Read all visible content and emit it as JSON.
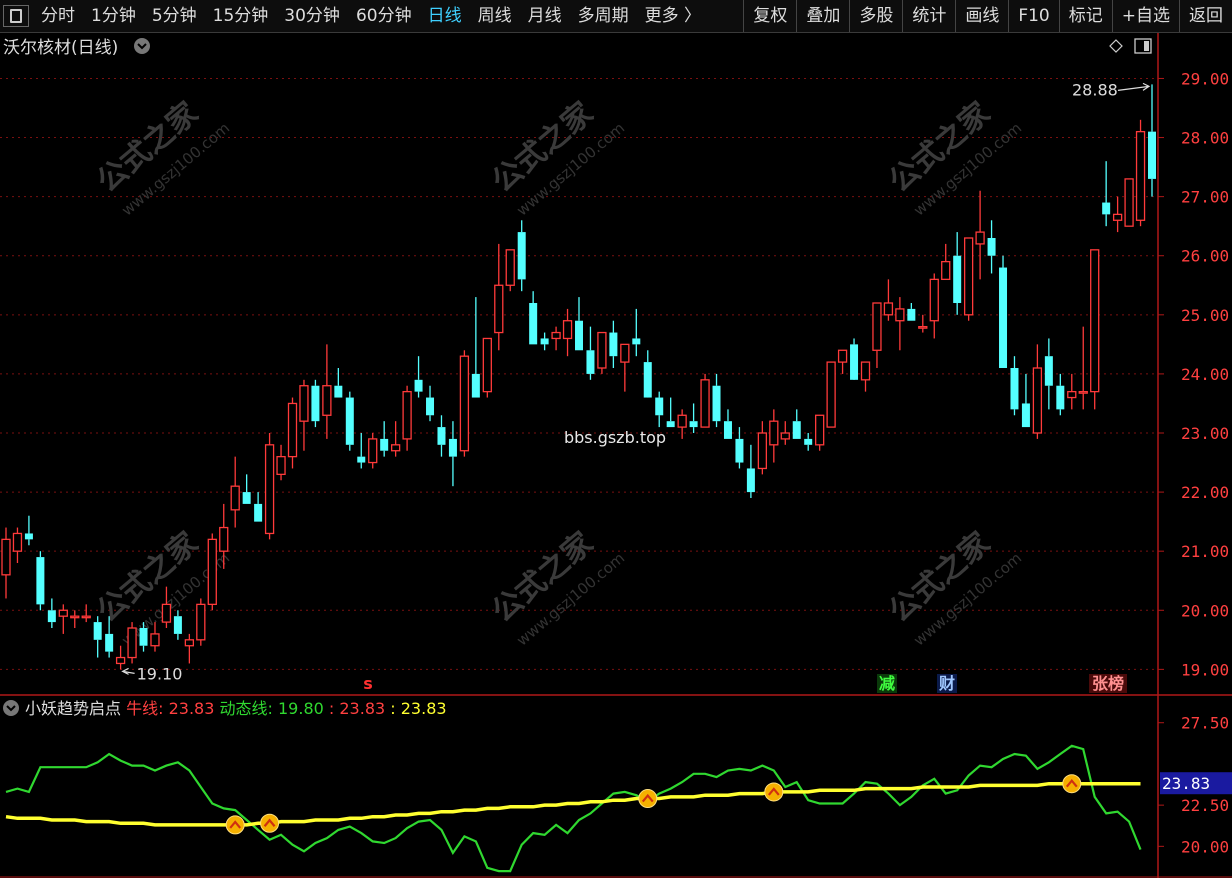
{
  "toolbar": {
    "items": [
      "分时",
      "1分钟",
      "5分钟",
      "15分钟",
      "30分钟",
      "60分钟",
      "日线",
      "周线",
      "月线",
      "多周期",
      "更多 〉"
    ],
    "active_index": 6,
    "right_items": [
      "复权",
      "叠加",
      "多股",
      "统计",
      "画线",
      "F10",
      "标记",
      "+自选",
      "返回"
    ]
  },
  "chart": {
    "stock_title": "沃尔核材(日线)",
    "watermark_cn": "公式之家",
    "watermark_url": "www.gszj100.com",
    "center_watermark": "bbs.gszb.top",
    "high_label": "28.88",
    "low_label": "19.10",
    "markers": [
      {
        "text": "s",
        "color": "#ff3030",
        "bg": "none"
      },
      {
        "text": "减",
        "color": "#40ff40",
        "bg": "#0a3a0a"
      },
      {
        "text": "财",
        "color": "#a0c8ff",
        "bg": "#0a1a4a"
      },
      {
        "text": "张榜",
        "color": "#ff9090",
        "bg": "#4a0a0a"
      }
    ],
    "colors": {
      "up": "#ff3a3a",
      "down": "#54ffff",
      "grid": "#7a1010",
      "axis": "#b01818",
      "bull": "#ffff30",
      "dyn": "#30d830"
    }
  },
  "indicator": {
    "name": "小妖趋势启点",
    "bull_label": "牛线:",
    "bull_value": "23.83",
    "dyn_label": "动态线:",
    "dyn_value": "19.80",
    "v3": ": 23.83",
    "v4": ": 23.83",
    "current_tag": "23.83"
  },
  "chart_data": {
    "type": "candlestick",
    "price_axis": {
      "ticks": [
        "29.00",
        "28.00",
        "27.00",
        "26.00",
        "25.00",
        "24.00",
        "23.00",
        "22.00",
        "21.00",
        "20.00",
        "19.00"
      ],
      "range": [
        18.6,
        29.6
      ]
    },
    "indicator_axis": {
      "ticks": [
        "27.50",
        "22.50",
        "20.00"
      ],
      "range": [
        18.2,
        29.0
      ]
    },
    "candles": [
      [
        20.6,
        21.4,
        20.2,
        21.2
      ],
      [
        21.0,
        21.4,
        20.8,
        21.3
      ],
      [
        21.3,
        21.6,
        21.1,
        21.2
      ],
      [
        20.9,
        21.0,
        20.0,
        20.1
      ],
      [
        20.0,
        20.2,
        19.7,
        19.8
      ],
      [
        19.9,
        20.1,
        19.6,
        20.0
      ],
      [
        19.9,
        20.0,
        19.7,
        19.9
      ],
      [
        19.9,
        20.1,
        19.8,
        19.9
      ],
      [
        19.8,
        19.9,
        19.2,
        19.5
      ],
      [
        19.6,
        19.9,
        19.2,
        19.3
      ],
      [
        19.1,
        19.4,
        19.0,
        19.2
      ],
      [
        19.2,
        19.8,
        19.1,
        19.7
      ],
      [
        19.7,
        19.8,
        19.3,
        19.4
      ],
      [
        19.4,
        19.8,
        19.3,
        19.6
      ],
      [
        19.8,
        20.4,
        19.7,
        20.1
      ],
      [
        19.9,
        20.0,
        19.5,
        19.6
      ],
      [
        19.4,
        19.6,
        19.1,
        19.5
      ],
      [
        19.5,
        20.2,
        19.4,
        20.1
      ],
      [
        20.1,
        21.3,
        20.0,
        21.2
      ],
      [
        21.0,
        21.8,
        20.7,
        21.4
      ],
      [
        21.7,
        22.6,
        21.4,
        22.1
      ],
      [
        22.0,
        22.3,
        21.8,
        21.8
      ],
      [
        21.8,
        22.0,
        21.5,
        21.5
      ],
      [
        21.3,
        23.0,
        21.2,
        22.8
      ],
      [
        22.3,
        22.8,
        22.2,
        22.6
      ],
      [
        22.6,
        23.6,
        22.4,
        23.5
      ],
      [
        23.2,
        23.9,
        22.7,
        23.8
      ],
      [
        23.8,
        23.9,
        23.1,
        23.2
      ],
      [
        23.3,
        24.5,
        22.9,
        23.8
      ],
      [
        23.8,
        24.1,
        23.6,
        23.6
      ],
      [
        23.6,
        23.7,
        22.7,
        22.8
      ],
      [
        22.6,
        23.0,
        22.4,
        22.5
      ],
      [
        22.5,
        23.0,
        22.4,
        22.9
      ],
      [
        22.9,
        23.2,
        22.6,
        22.7
      ],
      [
        22.7,
        23.2,
        22.6,
        22.8
      ],
      [
        22.9,
        23.8,
        22.7,
        23.7
      ],
      [
        23.9,
        24.3,
        23.6,
        23.7
      ],
      [
        23.6,
        23.8,
        23.2,
        23.3
      ],
      [
        23.1,
        23.3,
        22.6,
        22.8
      ],
      [
        22.9,
        23.2,
        22.1,
        22.6
      ],
      [
        22.7,
        24.4,
        22.6,
        24.3
      ],
      [
        24.0,
        25.3,
        23.6,
        23.6
      ],
      [
        23.7,
        24.6,
        23.6,
        24.6
      ],
      [
        24.7,
        26.2,
        24.4,
        25.5
      ],
      [
        25.5,
        26.0,
        25.4,
        26.1
      ],
      [
        26.4,
        26.6,
        25.4,
        25.6
      ],
      [
        25.2,
        25.4,
        24.5,
        24.5
      ],
      [
        24.6,
        24.7,
        24.4,
        24.5
      ],
      [
        24.6,
        24.8,
        24.4,
        24.7
      ],
      [
        24.6,
        25.1,
        24.3,
        24.9
      ],
      [
        24.9,
        25.3,
        24.4,
        24.4
      ],
      [
        24.4,
        24.8,
        23.9,
        24.0
      ],
      [
        24.1,
        24.4,
        24.0,
        24.7
      ],
      [
        24.7,
        24.9,
        24.1,
        24.3
      ],
      [
        24.2,
        24.4,
        23.7,
        24.5
      ],
      [
        24.6,
        25.1,
        24.3,
        24.5
      ],
      [
        24.2,
        24.4,
        23.7,
        23.6
      ],
      [
        23.6,
        23.7,
        23.1,
        23.3
      ],
      [
        23.2,
        23.6,
        23.1,
        23.1
      ],
      [
        23.1,
        23.4,
        22.9,
        23.3
      ],
      [
        23.2,
        23.5,
        23.0,
        23.1
      ],
      [
        23.1,
        24.0,
        23.1,
        23.9
      ],
      [
        23.8,
        24.0,
        23.1,
        23.2
      ],
      [
        23.2,
        23.4,
        22.9,
        22.9
      ],
      [
        22.9,
        23.1,
        22.4,
        22.5
      ],
      [
        22.4,
        22.8,
        21.9,
        22.0
      ],
      [
        22.4,
        23.2,
        22.3,
        23.0
      ],
      [
        22.8,
        23.4,
        22.5,
        23.2
      ],
      [
        22.9,
        23.2,
        22.8,
        23.0
      ],
      [
        23.2,
        23.4,
        22.9,
        22.9
      ],
      [
        22.9,
        23.0,
        22.7,
        22.8
      ],
      [
        22.8,
        23.3,
        22.7,
        23.3
      ],
      [
        23.1,
        24.2,
        23.1,
        24.2
      ],
      [
        24.2,
        24.4,
        24.0,
        24.4
      ],
      [
        24.5,
        24.6,
        24.0,
        23.9
      ],
      [
        23.9,
        24.0,
        23.7,
        24.2
      ],
      [
        24.4,
        25.2,
        24.1,
        25.2
      ],
      [
        25.0,
        25.6,
        24.9,
        25.2
      ],
      [
        24.9,
        25.3,
        24.4,
        25.1
      ],
      [
        25.1,
        25.2,
        24.9,
        24.9
      ],
      [
        24.8,
        25.0,
        24.7,
        24.8
      ],
      [
        24.9,
        25.7,
        24.6,
        25.6
      ],
      [
        25.6,
        26.2,
        25.6,
        25.9
      ],
      [
        26.0,
        26.4,
        25.0,
        25.2
      ],
      [
        25.0,
        26.3,
        24.9,
        26.3
      ],
      [
        26.2,
        27.1,
        25.6,
        26.4
      ],
      [
        26.3,
        26.6,
        25.7,
        26.0
      ],
      [
        25.8,
        26.0,
        24.1,
        24.1
      ],
      [
        24.1,
        24.3,
        23.3,
        23.4
      ],
      [
        23.5,
        24.0,
        23.1,
        23.1
      ],
      [
        23.0,
        24.5,
        22.9,
        24.1
      ],
      [
        24.3,
        24.6,
        23.4,
        23.8
      ],
      [
        23.8,
        24.0,
        23.3,
        23.4
      ],
      [
        23.6,
        24.0,
        23.4,
        23.7
      ],
      [
        23.7,
        24.8,
        23.4,
        23.7
      ],
      [
        23.7,
        26.1,
        23.4,
        26.1
      ],
      [
        26.9,
        27.6,
        26.5,
        26.7
      ],
      [
        26.6,
        27.0,
        26.4,
        26.7
      ],
      [
        26.5,
        27.3,
        26.5,
        27.3
      ],
      [
        26.6,
        28.3,
        26.5,
        28.1
      ],
      [
        28.1,
        28.9,
        27.0,
        27.3
      ]
    ],
    "series": [
      {
        "name": "牛线",
        "values": [
          21.8,
          21.7,
          21.7,
          21.7,
          21.6,
          21.6,
          21.6,
          21.5,
          21.5,
          21.5,
          21.4,
          21.4,
          21.4,
          21.3,
          21.3,
          21.3,
          21.3,
          21.3,
          21.3,
          21.3,
          21.3,
          21.3,
          21.4,
          21.4,
          21.5,
          21.5,
          21.5,
          21.6,
          21.6,
          21.6,
          21.7,
          21.7,
          21.8,
          21.8,
          21.9,
          21.9,
          22.0,
          22.0,
          22.1,
          22.1,
          22.2,
          22.2,
          22.3,
          22.3,
          22.4,
          22.4,
          22.4,
          22.5,
          22.5,
          22.6,
          22.6,
          22.7,
          22.7,
          22.8,
          22.8,
          22.9,
          22.9,
          22.9,
          23.0,
          23.0,
          23.0,
          23.1,
          23.1,
          23.1,
          23.2,
          23.2,
          23.2,
          23.3,
          23.3,
          23.3,
          23.3,
          23.4,
          23.4,
          23.4,
          23.4,
          23.5,
          23.5,
          23.5,
          23.5,
          23.5,
          23.6,
          23.6,
          23.6,
          23.6,
          23.6,
          23.7,
          23.7,
          23.7,
          23.7,
          23.7,
          23.7,
          23.8,
          23.8,
          23.8,
          23.8,
          23.8,
          23.8,
          23.8,
          23.8,
          23.8
        ]
      },
      {
        "name": "动态线",
        "values": [
          23.3,
          23.5,
          23.3,
          24.8,
          24.8,
          24.8,
          24.8,
          24.8,
          25.1,
          25.6,
          25.2,
          24.9,
          24.9,
          24.6,
          24.9,
          25.1,
          24.6,
          23.6,
          22.6,
          22.3,
          22.2,
          21.6,
          21.0,
          20.4,
          20.7,
          20.1,
          19.7,
          20.2,
          20.5,
          21.0,
          21.2,
          20.8,
          20.3,
          20.2,
          20.5,
          21.1,
          21.5,
          21.6,
          21.0,
          19.6,
          20.6,
          20.3,
          18.7,
          18.5,
          18.5,
          20.1,
          20.8,
          20.7,
          21.3,
          20.8,
          21.6,
          22.0,
          22.6,
          23.2,
          23.3,
          23.1,
          22.7,
          23.2,
          23.5,
          23.9,
          24.4,
          24.4,
          24.2,
          24.6,
          24.7,
          24.6,
          24.9,
          24.6,
          23.6,
          23.9,
          22.8,
          22.6,
          22.6,
          22.6,
          23.2,
          23.9,
          23.8,
          23.2,
          22.5,
          23.0,
          23.7,
          24.1,
          23.2,
          23.4,
          24.3,
          24.9,
          24.8,
          25.3,
          25.6,
          25.5,
          24.7,
          25.1,
          25.6,
          26.1,
          25.9,
          23.0,
          22.0,
          22.1,
          21.5,
          19.8
        ]
      }
    ],
    "signal_indices": [
      20,
      23,
      56,
      67,
      93
    ]
  }
}
